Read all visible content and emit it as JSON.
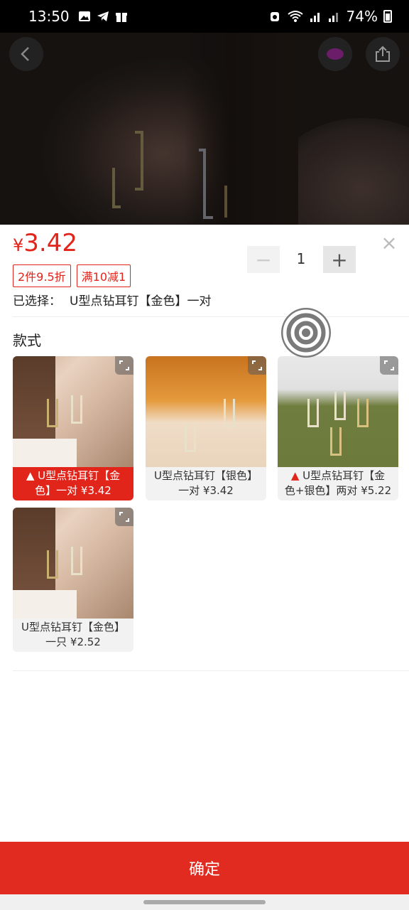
{
  "status_bar": {
    "time": "13:50",
    "battery": "74%",
    "icons": [
      "gallery-icon",
      "telegram-icon",
      "gift-icon",
      "alarm-icon",
      "wifi-icon",
      "signal-icon",
      "signal-icon-2",
      "battery-icon"
    ]
  },
  "header": {
    "back_icon": "chevron-left-icon",
    "favorite_icon": "favorite-icon",
    "share_icon": "share-icon"
  },
  "product": {
    "price_symbol": "¥",
    "price": "3.42",
    "tags": [
      "2件9.5折",
      "满10减1"
    ],
    "selected_label": "已选择：",
    "selected_value": "U型点钻耳钉【金色】一对",
    "quantity": "1",
    "minus_label": "−",
    "plus_label": "+",
    "close_label": "×"
  },
  "section": {
    "title": "款式"
  },
  "options": [
    {
      "line1": "U型点钻耳钉【金",
      "line2": "色】一对 ¥3.42",
      "hot": true,
      "selected": true
    },
    {
      "line1": "U型点钻耳钉【银色】",
      "line2": "一对 ¥3.42",
      "hot": false,
      "selected": false
    },
    {
      "line1": "U型点钻耳钉【金",
      "line2": "色+银色】两对 ¥5.22",
      "hot": true,
      "selected": false
    },
    {
      "line1": "U型点钻耳钉【金色】",
      "line2": "一只 ¥2.52",
      "hot": false,
      "selected": false
    }
  ],
  "footer": {
    "confirm_label": "确定"
  },
  "colors": {
    "accent": "#e1251b",
    "confirm_bg": "#e12b20"
  }
}
